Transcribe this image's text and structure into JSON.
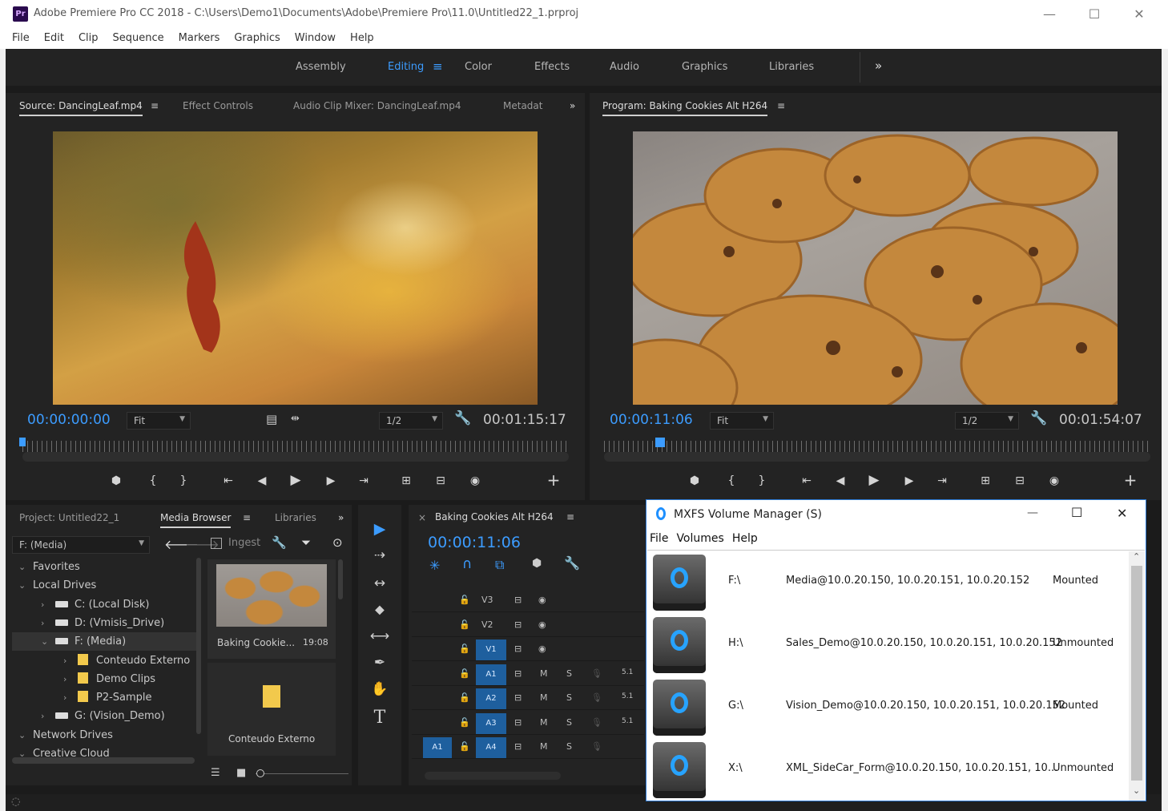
{
  "window": {
    "app_icon": "Pr",
    "title": "Adobe Premiere Pro CC 2018 - C:\\Users\\Demo1\\Documents\\Adobe\\Premiere Pro\\11.0\\Untitled22_1.prproj",
    "minimize": "—",
    "maximize": "☐",
    "close": "✕"
  },
  "menubar": [
    "File",
    "Edit",
    "Clip",
    "Sequence",
    "Markers",
    "Graphics",
    "Window",
    "Help"
  ],
  "workspaces": {
    "tabs": [
      "Assembly",
      "Editing",
      "Color",
      "Effects",
      "Audio",
      "Graphics",
      "Libraries"
    ],
    "active": "Editing",
    "menu_glyph": "≡",
    "overflow": "»"
  },
  "source_panel": {
    "tabs": [
      "Source: DancingLeaf.mp4",
      "Effect Controls",
      "Audio Clip Mixer: DancingLeaf.mp4",
      "Metadat"
    ],
    "menu_glyph": "≡",
    "overflow": "»",
    "timecode": "00:00:00:00",
    "fit": "Fit",
    "resolution": "1/2",
    "duration": "00:01:15:17",
    "playhead_fraction": 0.0
  },
  "program_panel": {
    "tab": "Program: Baking Cookies Alt H264",
    "menu_glyph": "≡",
    "timecode": "00:00:11:06",
    "fit": "Fit",
    "resolution": "1/2",
    "duration": "00:01:54:07",
    "playhead_fraction": 0.1
  },
  "transport_icons": {
    "marker": "⬢",
    "mark_in": "{",
    "mark_out": "}",
    "go_to_in": "⇤",
    "step_back": "◀",
    "play": "▶",
    "step_forward": "▶",
    "go_to_out": "⇥",
    "insert": "⊞",
    "overwrite": "⊟",
    "export_frame": "◉",
    "add": "+"
  },
  "project_panel": {
    "tabs": [
      "Project: Untitled22_1",
      "Media Browser",
      "Libraries"
    ],
    "overflow": "»",
    "location": "F: (Media)",
    "ingest": "Ingest",
    "tree": [
      {
        "label": "Favorites",
        "level": 0,
        "icon": "none",
        "arrow": "⌄"
      },
      {
        "label": "Local Drives",
        "level": 0,
        "icon": "none",
        "arrow": "⌄"
      },
      {
        "label": "C: (Local Disk)",
        "level": 1,
        "icon": "drive",
        "arrow": "›"
      },
      {
        "label": "D: (Vmisis_Drive)",
        "level": 1,
        "icon": "drive",
        "arrow": "›"
      },
      {
        "label": "F: (Media)",
        "level": 1,
        "icon": "drive",
        "arrow": "⌄"
      },
      {
        "label": "Conteudo Externo",
        "level": 2,
        "icon": "folder",
        "arrow": "›"
      },
      {
        "label": "Demo Clips",
        "level": 2,
        "icon": "folder",
        "arrow": "›"
      },
      {
        "label": "P2-Sample",
        "level": 2,
        "icon": "folder",
        "arrow": "›"
      },
      {
        "label": "G: (Vision_Demo)",
        "level": 1,
        "icon": "drive",
        "arrow": "›"
      },
      {
        "label": "Network Drives",
        "level": 0,
        "icon": "none",
        "arrow": "⌄"
      },
      {
        "label": "Creative Cloud",
        "level": 0,
        "icon": "none",
        "arrow": "⌄"
      }
    ],
    "clip_name": "Baking Cookie...",
    "clip_duration": "19:08",
    "folder_name": "Conteudo Externo"
  },
  "tools": [
    "▶",
    "⇢",
    "↔",
    "⬥",
    "⟷",
    "✒",
    "✋",
    "T"
  ],
  "timeline": {
    "tab": "Baking Cookies Alt H264",
    "close": "×",
    "menu_glyph": "≡",
    "timecode": "00:00:11:06",
    "video_tracks": [
      {
        "name": "V3",
        "target": ""
      },
      {
        "name": "V2",
        "target": ""
      },
      {
        "name": "V1",
        "target": "V1"
      }
    ],
    "audio_tracks": [
      {
        "name": "A1",
        "source": "",
        "vol": "5.1"
      },
      {
        "name": "A2",
        "source": "",
        "vol": "5.1"
      },
      {
        "name": "A3",
        "source": "",
        "vol": "5.1"
      },
      {
        "name": "A4",
        "source": "A1",
        "vol": ""
      }
    ],
    "m": "M",
    "s": "S"
  },
  "mxfs": {
    "title": "MXFS Volume Manager (S)",
    "menu": [
      "File",
      "Volumes",
      "Help"
    ],
    "minimize": "—",
    "maximize": "☐",
    "close": "✕",
    "volumes": [
      {
        "drive": "F:\\",
        "path": "Media@10.0.20.150, 10.0.20.151, 10.0.20.152",
        "status": "Mounted"
      },
      {
        "drive": "H:\\",
        "path": "Sales_Demo@10.0.20.150, 10.0.20.151, 10.0.20.152",
        "status": "Unmounted"
      },
      {
        "drive": "G:\\",
        "path": "Vision_Demo@10.0.20.150, 10.0.20.151, 10.0.20.152",
        "status": "Mounted"
      },
      {
        "drive": "X:\\",
        "path": "XML_SideCar_Form@10.0.20.150, 10.0.20.151, 10...",
        "status": "Unmounted"
      }
    ]
  },
  "colors": {
    "accent": "#3c9cff",
    "panel_bg": "#232323",
    "app_bg": "#1b1b1b",
    "track_target": "#1e5f9e",
    "mxfs_border": "#2d7ad6"
  }
}
